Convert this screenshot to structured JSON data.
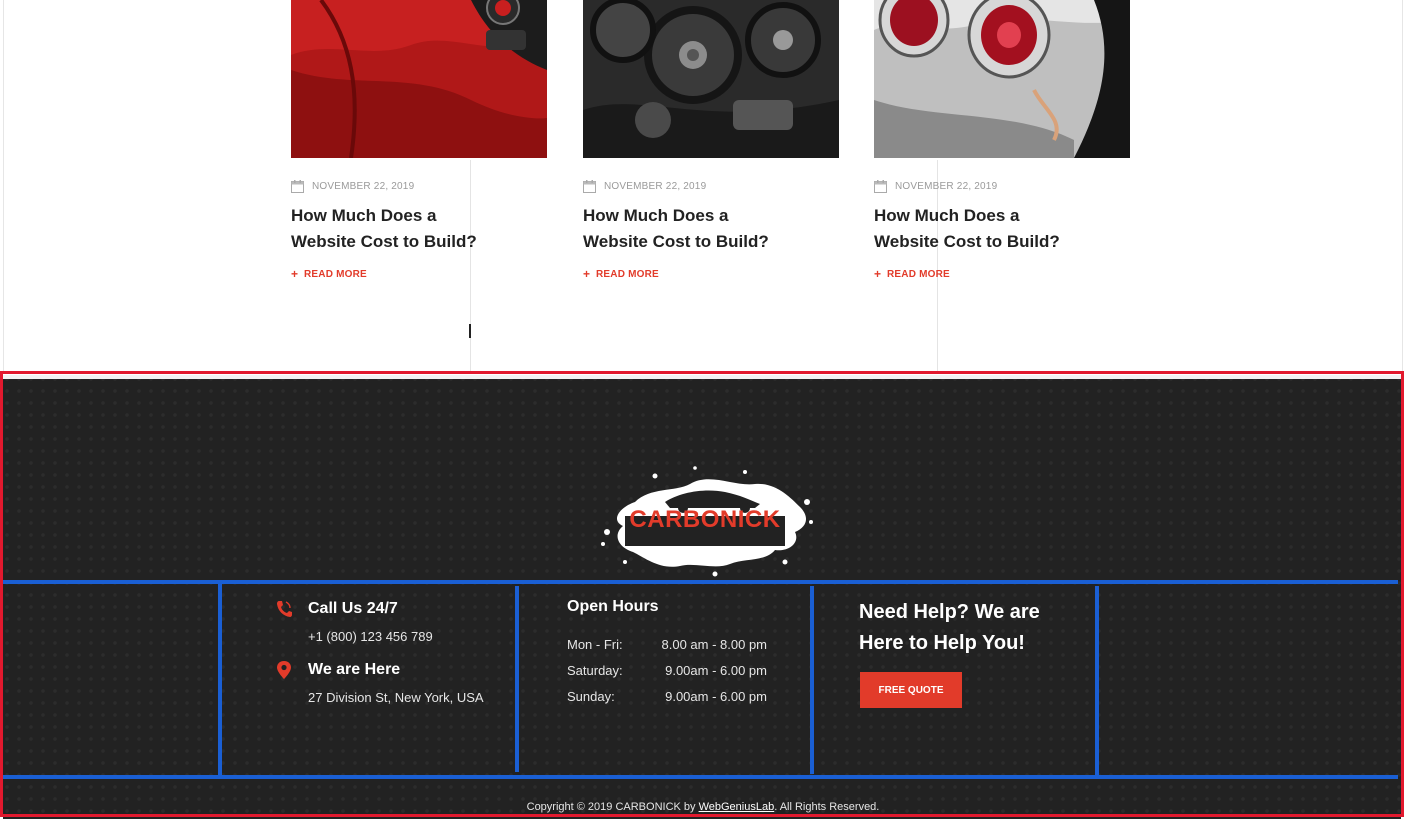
{
  "blog": {
    "posts": [
      {
        "date": "NOVEMBER 22, 2019",
        "title": "How Much Does a Website Cost to Build?",
        "read_more": "READ MORE",
        "image": "red-car-interior-photo"
      },
      {
        "date": "NOVEMBER 22, 2019",
        "title": "How Much Does a Website Cost to Build?",
        "read_more": "READ MORE",
        "image": "engine-belt-photo"
      },
      {
        "date": "NOVEMBER 22, 2019",
        "title": "How Much Does a Website Cost to Build?",
        "read_more": "READ MORE",
        "image": "chrome-taillights-photo"
      }
    ]
  },
  "footer": {
    "logo_text": "CARBONICK",
    "contact": {
      "call_heading": "Call Us 24/7",
      "phone": "+1 (800) 123 456 789",
      "location_heading": "We are Here",
      "address": "27 Division St, New York, USA"
    },
    "hours": {
      "heading": "Open Hours",
      "rows": [
        {
          "day": "Mon - Fri:",
          "time": "8.00 am - 8.00 pm"
        },
        {
          "day": "Saturday:",
          "time": "9.00am - 6.00 pm"
        },
        {
          "day": "Sunday:",
          "time": "9.00am - 6.00 pm"
        }
      ]
    },
    "help": {
      "heading": "Need Help? We are Here to Help You!",
      "button": "FREE QUOTE"
    },
    "copyright": {
      "prefix": "Copyright © 2019 CARBONICK by ",
      "link": "WebGeniusLab",
      "suffix": ". All Rights Reserved."
    }
  },
  "colors": {
    "accent": "#e23b2a",
    "footer_bg": "#222222",
    "highlight_red": "#e2192e",
    "highlight_blue": "#1a5fd4"
  }
}
